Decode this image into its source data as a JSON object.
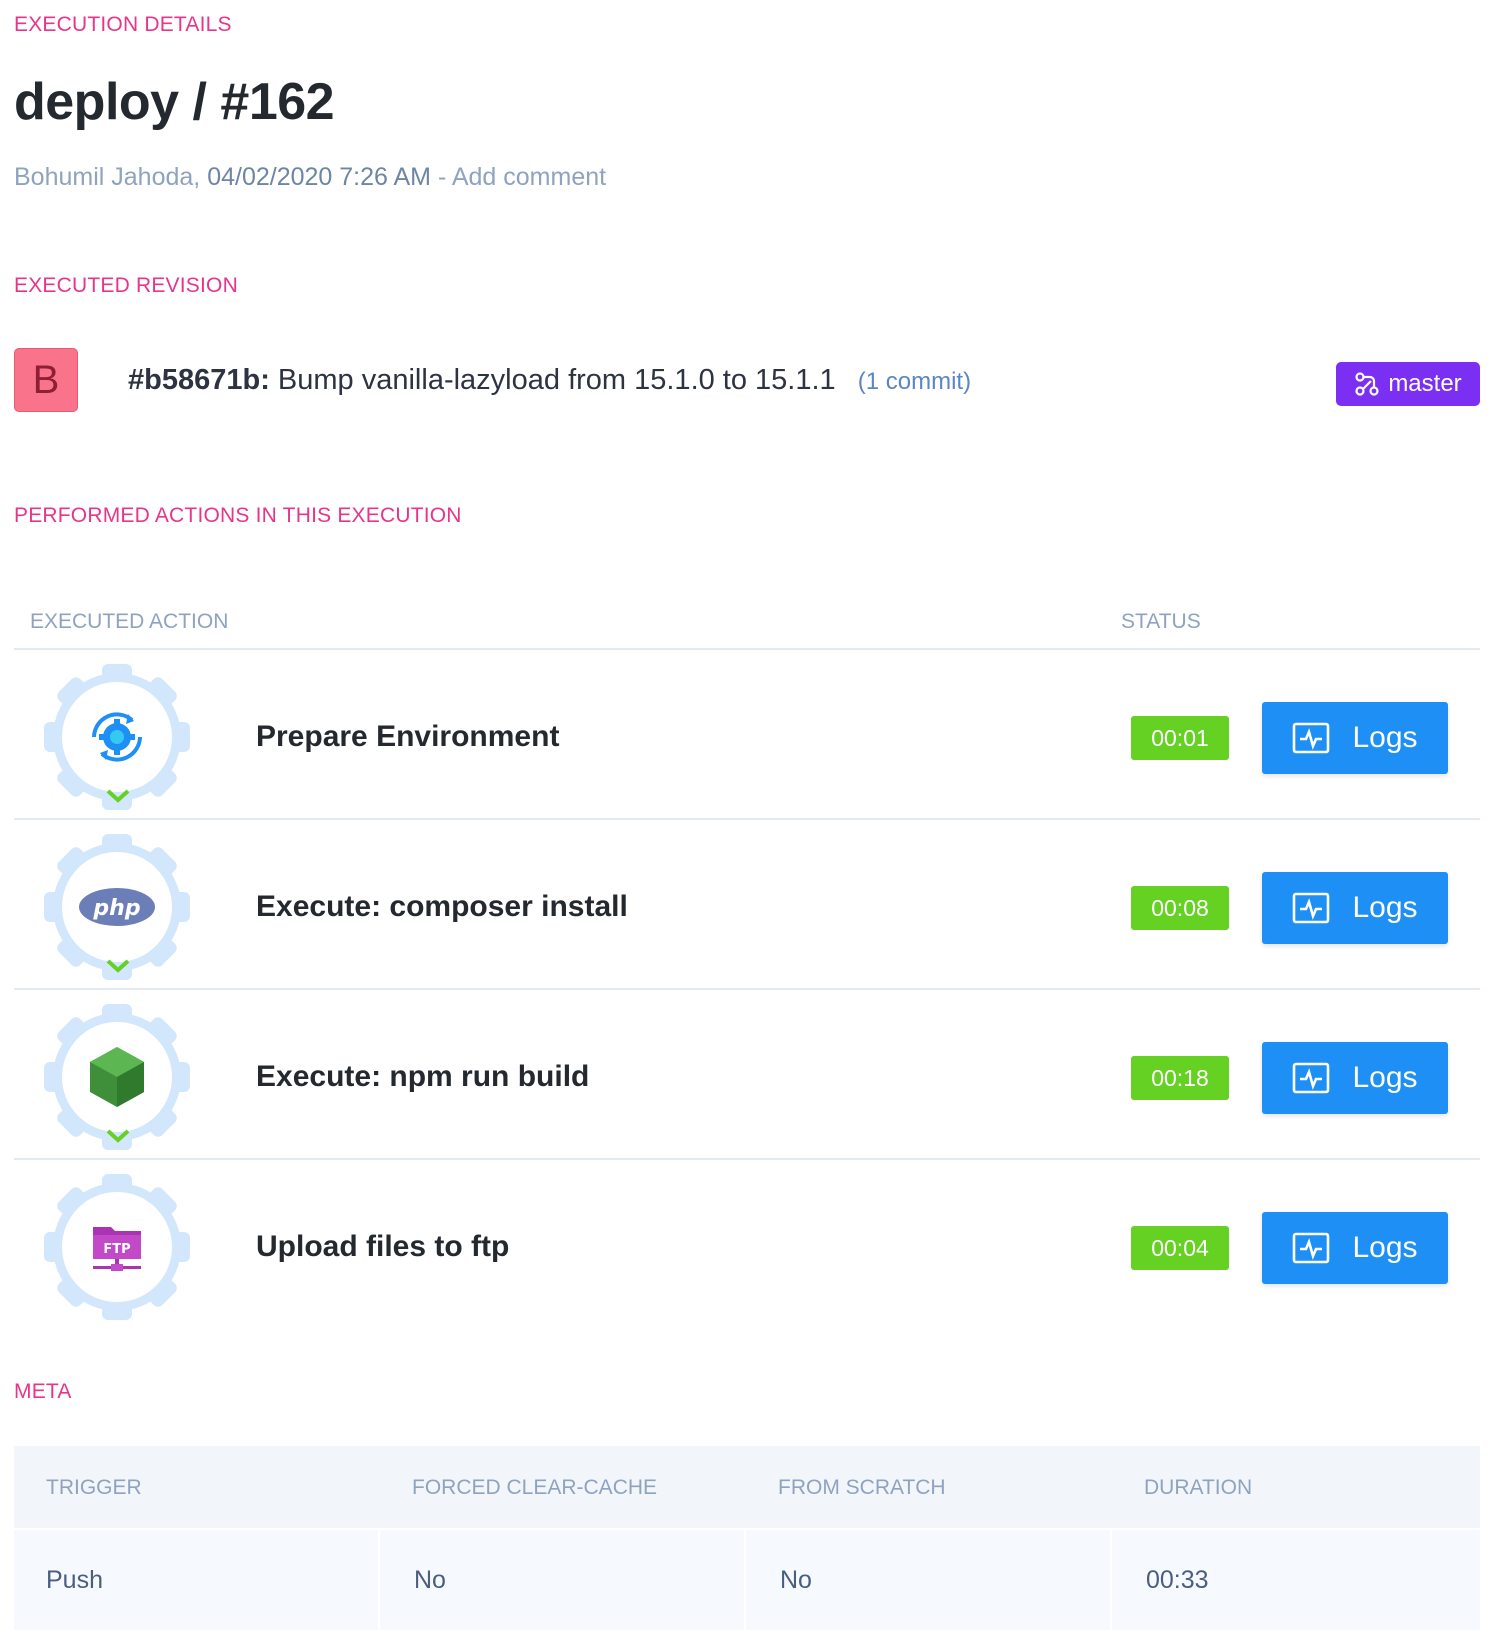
{
  "header": {
    "section_label": "EXECUTION DETAILS",
    "title": "deploy / #162",
    "author": "Bohumil Jahoda,",
    "date": "04/02/2020 7:26 AM",
    "separator": "-",
    "add_comment": "Add comment"
  },
  "revision": {
    "section_label": "EXECUTED REVISION",
    "avatar_letter": "B",
    "hash": "#b58671b:",
    "message": "Bump vanilla-lazyload from 15.1.0 to 15.1.1",
    "commits": "(1 commit)",
    "branch": "master",
    "branch_icon": "git-branch-icon"
  },
  "actions": {
    "section_label": "PERFORMED ACTIONS IN THIS EXECUTION",
    "col_action": "EXECUTED ACTION",
    "col_status": "STATUS",
    "items": [
      {
        "name": "Prepare Environment",
        "duration": "00:01",
        "logs_label": "Logs",
        "icon": "environment-gear-icon"
      },
      {
        "name": "Execute: composer install",
        "duration": "00:08",
        "logs_label": "Logs",
        "icon": "php-icon"
      },
      {
        "name": "Execute: npm run build",
        "duration": "00:18",
        "logs_label": "Logs",
        "icon": "nodejs-icon"
      },
      {
        "name": "Upload files to ftp",
        "duration": "00:04",
        "logs_label": "Logs",
        "icon": "ftp-icon"
      }
    ],
    "php_text": "php",
    "ftp_text": "FTP"
  },
  "meta": {
    "section_label": "META",
    "headers": [
      "TRIGGER",
      "FORCED CLEAR-CACHE",
      "FROM SCRATCH",
      "DURATION"
    ],
    "values": [
      "Push",
      "No",
      "No",
      "00:33"
    ]
  },
  "colors": {
    "accent_pink": "#e8358a",
    "status_green": "#65d123",
    "logs_blue": "#1e8ff5",
    "branch_purple": "#7b2ff2"
  }
}
